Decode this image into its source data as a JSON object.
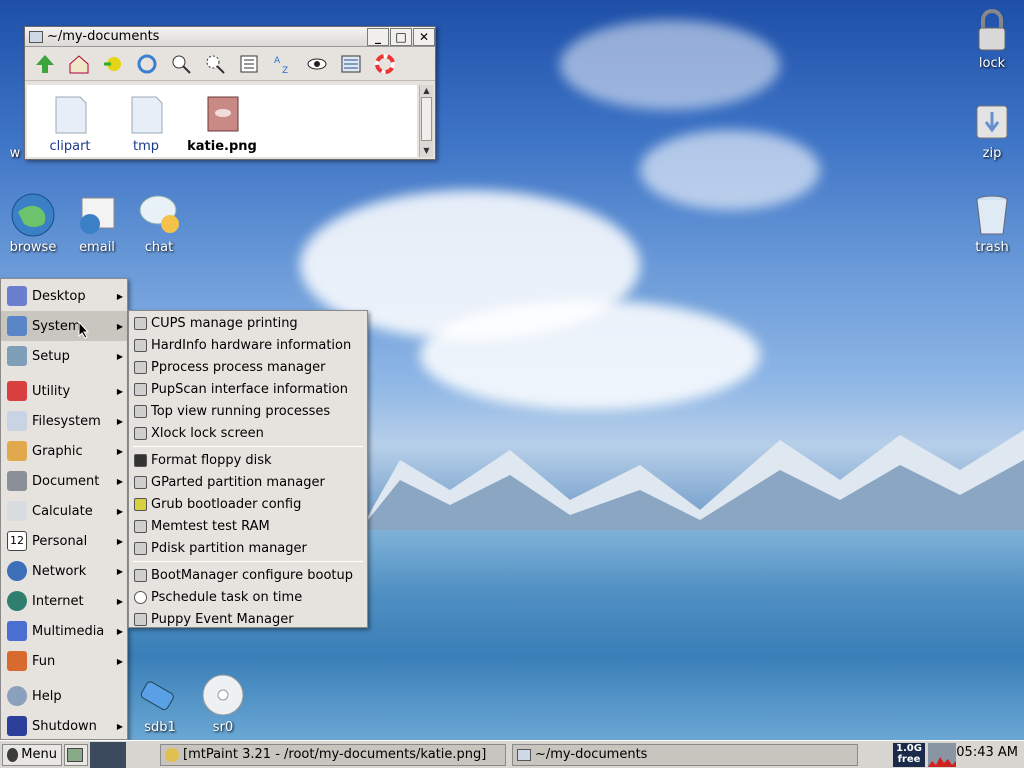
{
  "desktop": {
    "top_icons": [],
    "left_icons": [
      {
        "label": "browse"
      },
      {
        "label": "email"
      },
      {
        "label": "chat"
      },
      {
        "label": "w"
      }
    ],
    "right_icons": [
      {
        "label": "lock"
      },
      {
        "label": "zip"
      },
      {
        "label": "trash"
      }
    ],
    "drive_icons": [
      {
        "label": "sdb1"
      },
      {
        "label": "sr0"
      }
    ]
  },
  "file_window": {
    "title": "~/my-documents",
    "buttons": {
      "minimize": "_",
      "maximize": "□",
      "close": "✕"
    },
    "files": [
      {
        "name": "clipart",
        "kind": "folder"
      },
      {
        "name": "tmp",
        "kind": "folder"
      },
      {
        "name": "katie.png",
        "kind": "image"
      }
    ]
  },
  "main_menu": {
    "items": [
      {
        "label": "Desktop"
      },
      {
        "label": "System"
      },
      {
        "label": "Setup"
      },
      {
        "label": "Utility"
      },
      {
        "label": "Filesystem"
      },
      {
        "label": "Graphic"
      },
      {
        "label": "Document"
      },
      {
        "label": "Calculate"
      },
      {
        "label": "Personal"
      },
      {
        "label": "Network"
      },
      {
        "label": "Internet"
      },
      {
        "label": "Multimedia"
      },
      {
        "label": "Fun"
      },
      {
        "label": "Help"
      },
      {
        "label": "Shutdown"
      }
    ],
    "personal_icon_text": "12"
  },
  "system_submenu": {
    "group1": [
      "CUPS manage printing",
      "HardInfo hardware information",
      "Pprocess process manager",
      "PupScan interface information",
      "Top view running processes",
      "Xlock lock screen"
    ],
    "group2": [
      "Format floppy disk",
      "GParted partition manager",
      "Grub bootloader config",
      "Memtest test RAM",
      "Pdisk partition manager"
    ],
    "group3": [
      "BootManager configure bootup",
      "Pschedule task on time",
      "Puppy Event Manager"
    ]
  },
  "taskbar": {
    "menu_label": "Menu",
    "tasks": [
      "[mtPaint 3.21 - /root/my-documents/katie.png]",
      "~/my-documents"
    ],
    "free_top": "1.0G",
    "free_bottom": "free",
    "clock": "05:43 AM"
  },
  "colors": {
    "menu_bg": "#e6e3df",
    "desktop_sky": "#3e74c6",
    "label_text": "#ffffff"
  }
}
